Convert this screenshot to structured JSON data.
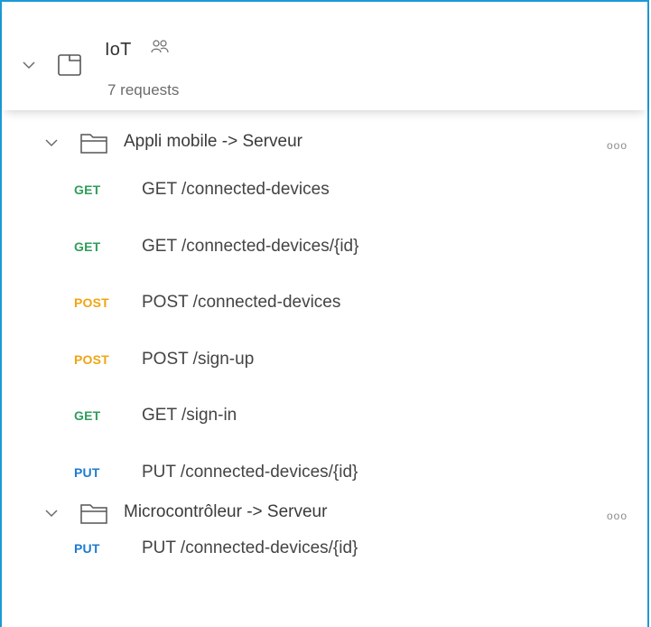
{
  "collection": {
    "name": "IoT",
    "meta": "7 requests",
    "icons": {
      "chevron": "chevron-down-icon",
      "collection": "collection-icon",
      "shared": "shared-people-icon"
    }
  },
  "folders": [
    {
      "label": "Appli mobile -> Serveur",
      "more": "ooo",
      "requests": [
        {
          "method": "GET",
          "label": "GET /connected-devices"
        },
        {
          "method": "GET",
          "label": "GET /connected-devices/{id}"
        },
        {
          "method": "POST",
          "label": "POST /connected-devices"
        },
        {
          "method": "POST",
          "label": "POST /sign-up"
        },
        {
          "method": "GET",
          "label": "GET /sign-in"
        },
        {
          "method": "PUT",
          "label": "PUT /connected-devices/{id}"
        }
      ]
    },
    {
      "label": "Microcontrôleur -> Serveur",
      "more": "ooo",
      "requests": [
        {
          "method": "PUT",
          "label": "PUT /connected-devices/{id}"
        }
      ]
    }
  ],
  "colors": {
    "frame": "#1a9bd7",
    "get": "#2e9e5b",
    "post": "#f0a512",
    "put": "#1f7ad1"
  }
}
